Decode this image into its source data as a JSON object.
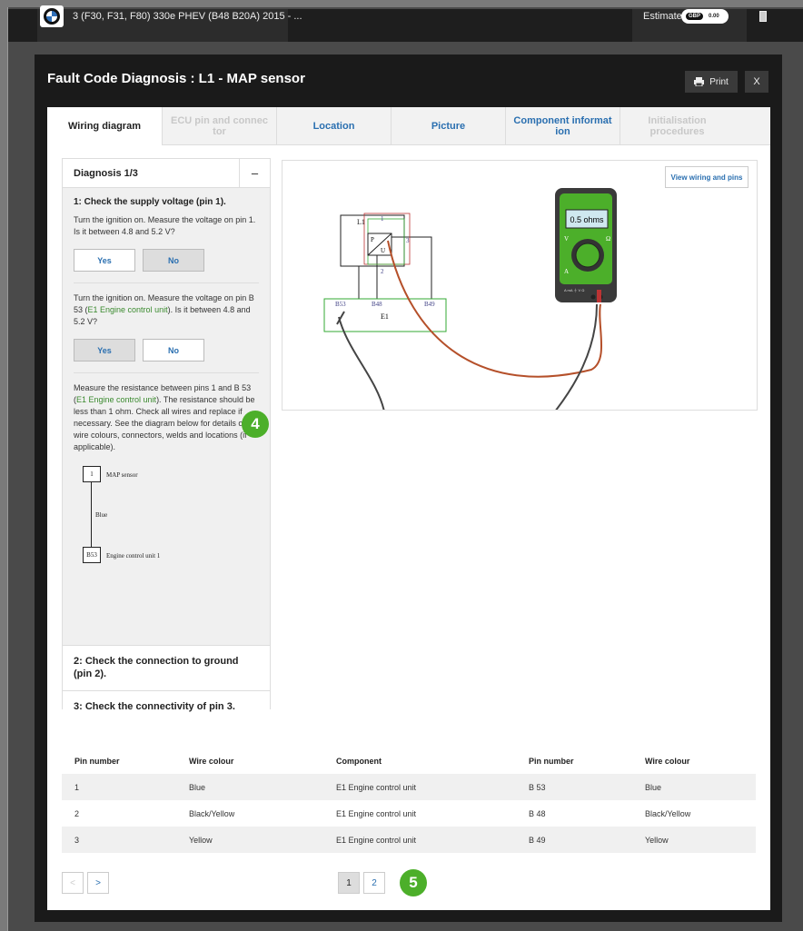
{
  "topbar": {
    "vehicle": "3 (F30, F31, F80) 330e PHEV (B48 B20A) 2015 - ...",
    "estimate_label": "Estimate",
    "currency": "GBP",
    "amount": "0.00"
  },
  "modal": {
    "title": "Fault Code Diagnosis : L1 - MAP sensor",
    "print_label": "Print",
    "close_label": "X"
  },
  "tabs": [
    {
      "label": "Wiring diagram",
      "state": "active"
    },
    {
      "label": "ECU pin and connec tor",
      "state": "disabled"
    },
    {
      "label": "Location",
      "state": "enabled"
    },
    {
      "label": "Picture",
      "state": "enabled"
    },
    {
      "label": "Component informat ion",
      "state": "enabled"
    },
    {
      "label": "Initialisation procedures",
      "state": "disabled"
    }
  ],
  "diagnosis": {
    "title": "Diagnosis 1/3",
    "collapse": "–",
    "step1": {
      "heading": "1: Check the supply voltage (pin 1).",
      "q1": "Turn the ignition on. Measure the voltage on pin 1. Is it between 4.8 and 5.2 V?",
      "q2_a": "Turn the ignition on. Measure the voltage on pin B 53 (",
      "q2_link": "E1 Engine control unit",
      "q2_b": "). Is it between 4.8 and 5.2 V?",
      "yes": "Yes",
      "no": "No",
      "q3_a": "Measure the resistance between pins 1 and B 53 (",
      "q3_link": "E1 Engine control unit",
      "q3_b": "). The resistance should be less than 1 ohm. Check all wires and replace if necessary. See the diagram below for details on wire colours, connectors, welds and locations (if applicable).",
      "mini": {
        "pin1": "1",
        "sensor": "MAP sensor",
        "wire": "Blue",
        "pin2": "B53",
        "ecu": "Engine control unit 1"
      }
    },
    "step2": "2: Check the connection to ground (pin 2).",
    "step3": "3: Check the connectivity of pin 3."
  },
  "badges": {
    "b4": "4",
    "b5": "5"
  },
  "wiring": {
    "view_button": "View wiring and pins",
    "meter_reading": "0.5 ohms",
    "labels": {
      "l1": "L1",
      "p1": "1",
      "p2": "2",
      "p3": "3",
      "b53": "B53",
      "b48": "B48",
      "b49": "B49",
      "e1": "E1",
      "p": "P",
      "u": "U",
      "v": "V",
      "omega": "Ω",
      "a": "A",
      "ports": "A  mA  ⏚  V  Ω"
    }
  },
  "table": {
    "headers": [
      "Pin number",
      "Wire colour",
      "Component",
      "Pin number",
      "Wire colour"
    ],
    "rows": [
      [
        "1",
        "Blue",
        "E1 Engine control unit",
        "B 53",
        "Blue"
      ],
      [
        "2",
        "Black/Yellow",
        "E1 Engine control unit",
        "B 48",
        "Black/Yellow"
      ],
      [
        "3",
        "Yellow",
        "E1 Engine control unit",
        "B 49",
        "Yellow"
      ]
    ]
  },
  "pager": {
    "prev": "<",
    "next": ">",
    "pages": [
      "1",
      "2"
    ]
  }
}
